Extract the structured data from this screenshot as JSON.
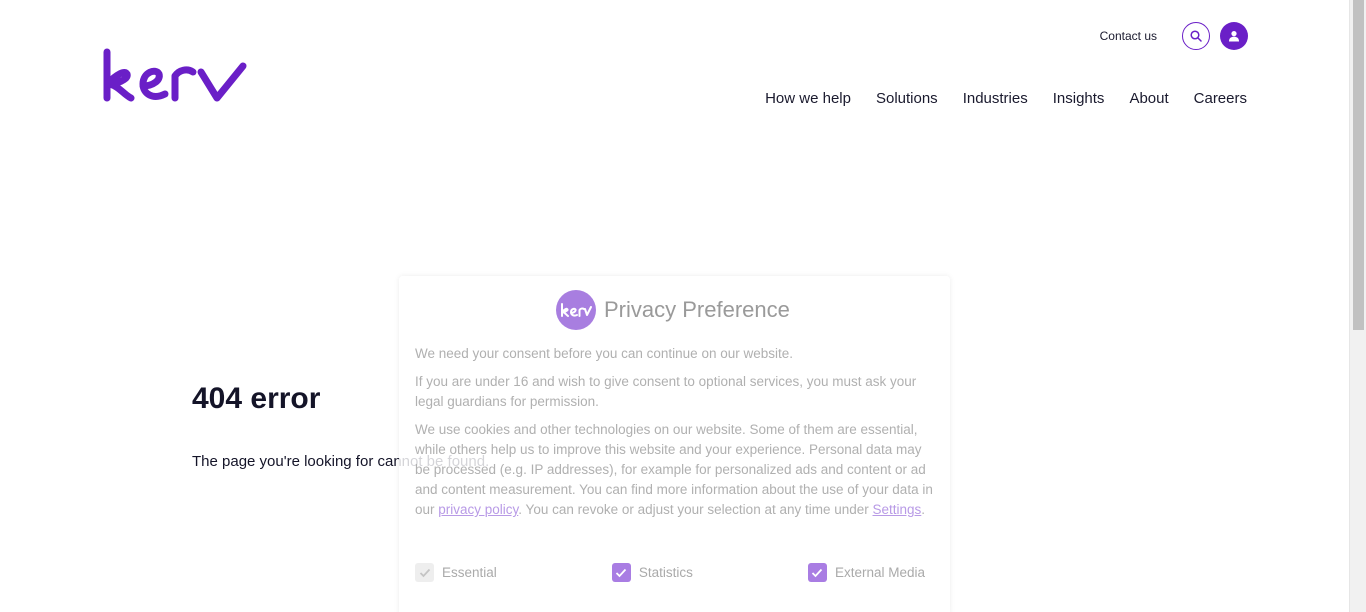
{
  "header": {
    "logo_text": "kerv",
    "contact_label": "Contact us",
    "search_icon": "search-icon",
    "account_icon": "user-icon"
  },
  "nav": {
    "items": [
      {
        "label": "How we help"
      },
      {
        "label": "Solutions"
      },
      {
        "label": "Industries"
      },
      {
        "label": "Insights"
      },
      {
        "label": "About"
      },
      {
        "label": "Careers"
      }
    ]
  },
  "error": {
    "title": "404 error",
    "message": "The page you're looking for cannot be found."
  },
  "consent": {
    "title": "Privacy Preference",
    "para1": "We need your consent before you can continue on our website.",
    "para2": "If you are under 16 and wish to give consent to optional services, you must ask your legal guardians for permission.",
    "para3_a": "We use cookies and other technologies on our website. Some of them are essential, while others help us to improve this website and your experience. Personal data may be processed (e.g. IP addresses), for example for personalized ads and content or ad and content measurement. You can find more information about the use of your data in our ",
    "privacy_link": "privacy policy",
    "para3_b": ". You can revoke or adjust your selection at any time under ",
    "settings_link": "Settings",
    "para3_c": ".",
    "checkboxes": [
      {
        "label": "Essential",
        "checked": true,
        "disabled": true
      },
      {
        "label": "Statistics",
        "checked": true,
        "disabled": false
      },
      {
        "label": "External Media",
        "checked": true,
        "disabled": false
      }
    ]
  },
  "colors": {
    "brand_purple": "#6a1fc7",
    "consent_accent": "#a97de3"
  }
}
